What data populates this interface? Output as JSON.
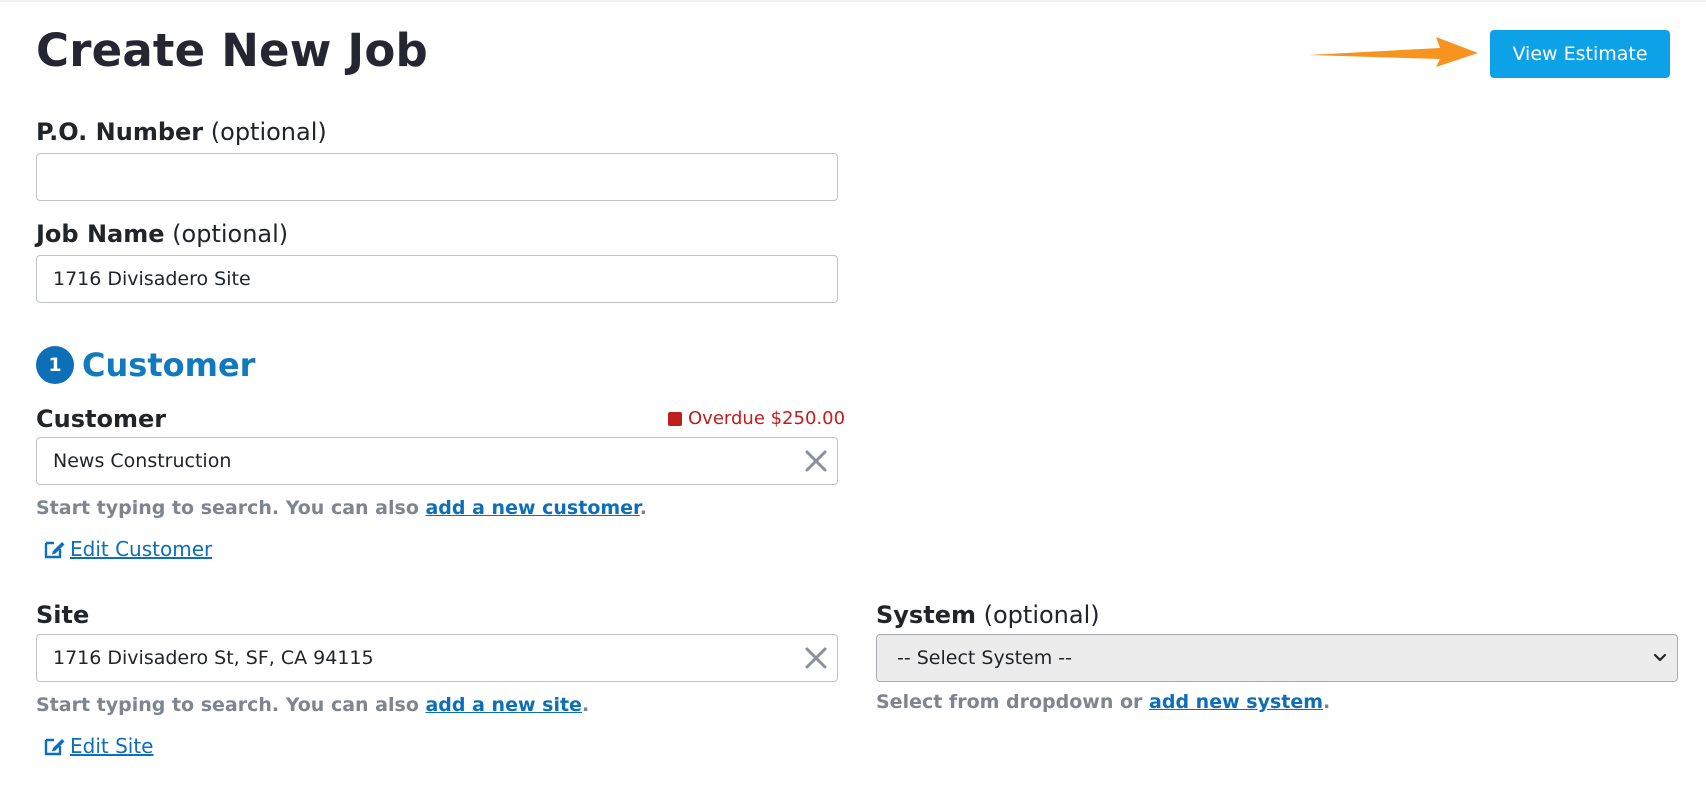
{
  "header": {
    "title": "Create New Job",
    "view_estimate_label": "View Estimate"
  },
  "po_number": {
    "label": "P.O. Number",
    "optional": "(optional)",
    "value": ""
  },
  "job_name": {
    "label": "Job Name",
    "optional": "(optional)",
    "value": "1716 Divisadero Site"
  },
  "customer_section": {
    "step": "1",
    "title": "Customer"
  },
  "customer": {
    "label": "Customer",
    "overdue": "Overdue $250.00",
    "value": "News Construction",
    "help_prefix": "Start typing to search. You can also ",
    "help_link": "add a new customer",
    "help_suffix": ".",
    "edit_label": "Edit Customer"
  },
  "site": {
    "label": "Site",
    "value": "1716 Divisadero St, SF, CA 94115",
    "help_prefix": "Start typing to search. You can also ",
    "help_link": "add a new site",
    "help_suffix": ".",
    "edit_label": "Edit Site"
  },
  "system": {
    "label": "System",
    "optional": "(optional)",
    "selected": "-- Select System --",
    "help_prefix": "Select from dropdown or ",
    "help_link": "add new system",
    "help_suffix": "."
  },
  "colors": {
    "primary_button": "#0da2e7",
    "link": "#0c6fb8",
    "overdue": "#c01d1d",
    "annotation_arrow": "#f7931e"
  },
  "icons": {
    "clear": "close-icon",
    "edit": "edit-icon",
    "dropdown": "chevron-down-icon"
  }
}
